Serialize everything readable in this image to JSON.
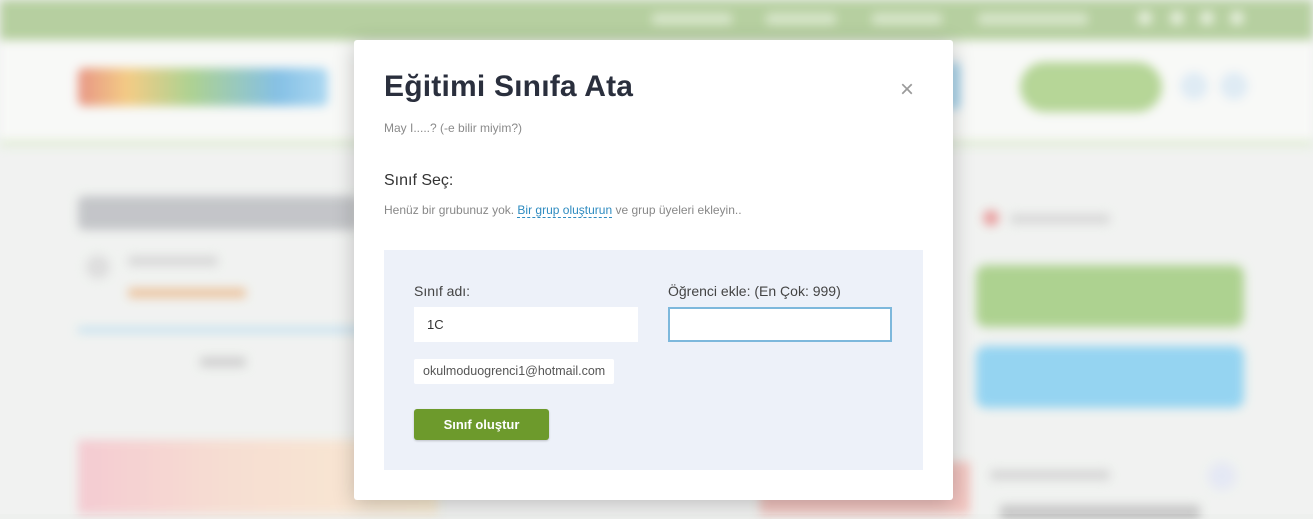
{
  "modal": {
    "title": "Eğitimi Sınıfa Ata",
    "close_icon": "×",
    "subtitle": "May I.....? (-e bilir miyim?)",
    "select_label": "Sınıf Seç:",
    "info_prefix": "Henüz bir grubunuz yok.",
    "info_link": "Bir grup oluşturun",
    "info_suffix": "ve grup üyeleri ekleyin..",
    "form": {
      "class_name_label": "Sınıf adı:",
      "class_name_value": "1C",
      "student_add_label": "Öğrenci ekle: (En Çok: 999)",
      "student_add_value": "",
      "student_chip": "okulmoduogrenci1@hotmail.com",
      "create_button": "Sınıf oluştur"
    }
  },
  "colors": {
    "accent_green": "#6d9a2c",
    "link_blue": "#2e8bc0",
    "panel_bg": "#edf1f9",
    "topbar_green": "#a6c58b"
  }
}
